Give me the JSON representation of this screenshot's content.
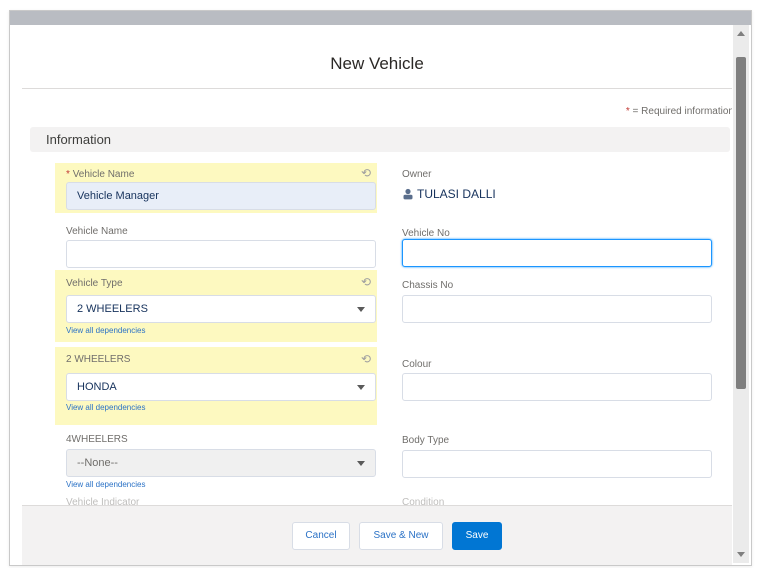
{
  "modal": {
    "title": "New Vehicle"
  },
  "required_note": {
    "star": "*",
    "text": "= Required information"
  },
  "section": {
    "title": "Information"
  },
  "fields": {
    "vehicle_name_req": {
      "star": "*",
      "label": "Vehicle Name",
      "value": "Vehicle Manager"
    },
    "owner": {
      "label": "Owner",
      "value": "TULASI DALLI"
    },
    "vehicle_name": {
      "label": "Vehicle Name",
      "value": ""
    },
    "vehicle_no": {
      "label": "Vehicle No",
      "value": ""
    },
    "vehicle_type": {
      "label": "Vehicle Type",
      "value": "2 WHEELERS",
      "link": "View all dependencies"
    },
    "chassis_no": {
      "label": "Chassis No",
      "value": ""
    },
    "two_wheelers": {
      "label": "2 WHEELERS",
      "value": "HONDA",
      "link": "View all dependencies"
    },
    "colour": {
      "label": "Colour",
      "value": ""
    },
    "four_wheelers": {
      "label": "4WHEELERS",
      "value": "--None--",
      "link": "View all dependencies"
    },
    "body_type": {
      "label": "Body Type",
      "value": ""
    }
  },
  "partial_labels": {
    "left": "Vehicle Indicator",
    "right": "Condition"
  },
  "footer": {
    "cancel_label": "Cancel",
    "save_new_label": "Save & New",
    "save_label": "Save"
  },
  "icons": {
    "undo": "undo-icon",
    "caret": "chevron-down-icon",
    "owner": "user-icon"
  },
  "colors": {
    "brand": "#0176d3",
    "highlight": "#fdf9c0",
    "focus": "#1b96ff",
    "link": "#2b72c6"
  }
}
